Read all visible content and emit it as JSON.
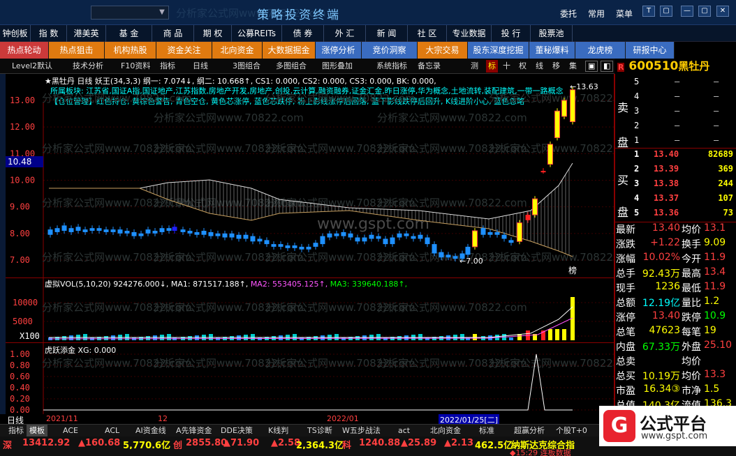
{
  "titlebar": {
    "app_title": "策略投资终端",
    "menu": [
      "委托",
      "常用",
      "菜单"
    ],
    "win_buttons": [
      "T",
      "▢",
      "—",
      "▢",
      "✕"
    ],
    "watermark_top": "分析家公式网www.70822.com"
  },
  "nav": [
    "钟创板",
    "指 数",
    "港美英",
    "基 金",
    "商 品",
    "期 权",
    "公募REITs",
    "债 券",
    "外 汇",
    "新 闻",
    "社 区",
    "专业数据",
    "投 行",
    "股票池"
  ],
  "subnav": [
    "热点轮动",
    "热点狙击",
    "机构热股",
    "资金关注",
    "北向资金",
    "大数据掘金",
    "涨停分析",
    "竞价洞察",
    "大宗交易",
    "股东深度挖掘",
    "董秘爆料",
    "龙虎榜",
    "研报中心"
  ],
  "toolbar": [
    "Level2默认",
    "技术分析",
    "F10资料",
    "指标",
    "日线",
    "3图组合",
    "多图组合",
    "图形叠加",
    "系统指标",
    "备忘录",
    "测",
    "标",
    "十",
    "权",
    "线",
    "移",
    "集"
  ],
  "stock": {
    "code": "600510",
    "name": "黑牡丹"
  },
  "indicator_line": "★黑牡丹 日线 妖王(34,3,3) 纲一: 7.074↓, 纲二: 10.668↑, CS1: 0.000, CS2: 0.000, CS3: 0.000, BK: 0.000,",
  "sector_line": "所属板块: 江苏省,国证A指,国证地产,江苏指数,房地产开发,房地产,创投,云计算,融资融券,证金汇金,昨日涨停,华为概念,土地流转,装配建筑,一带一路概念",
  "position_line": "【仓位管理】红色持仓, 黄棕色警告, 青色空仓, 黄色芯涨停, 蓝色芯跌停, 粉上影线涨停后回落, 蓝下影线跌停后回升, K线进阶小心, 蓝色忽略",
  "price_axis": [
    "13.00",
    "12.00",
    "11.00",
    "10.00",
    "9.00",
    "8.00",
    "7.00"
  ],
  "current_price_tag": "10.48",
  "high_marker": "13.63",
  "low_marker": "7.00",
  "bang_label": "榜",
  "vol_line": {
    "name": "虚拟VOL(5,10,20)",
    "v": "924276.000↓,",
    "ma1": "MA1: 871517.188↑,",
    "ma2": "MA2: 553405.125↑,",
    "ma3": "MA3: 339640.188↑,"
  },
  "vol_axis": [
    "10000",
    "5000",
    "X100"
  ],
  "sub_line": "虎跃添金 XG: 0.000",
  "sub_axis": [
    "1.00",
    "0.80",
    "0.60",
    "0.40",
    "0.20",
    "0.00"
  ],
  "date_axis": {
    "period": "日线",
    "d1": "2021/11",
    "d2": "12",
    "d3": "2022/01",
    "highlight": "2022/01/25[二]"
  },
  "bottom_tabs": [
    "指标",
    "模板",
    "ACE",
    "ACL",
    "AI资金线",
    "A先锋资金",
    "DDE决策",
    "K线判",
    "TS诊断",
    "W五步战法",
    "act",
    "北向资金",
    "标准",
    "超赢分析",
    "个股T+0"
  ],
  "index_bar": [
    {
      "t": "深",
      "c": "#ff4040"
    },
    {
      "t": "13412.92",
      "c": "#ff4040"
    },
    {
      "t": "▲160.68",
      "c": "#ff4040"
    },
    {
      "t": "5,770.6亿",
      "c": "#ffff00"
    },
    {
      "t": "创",
      "c": "#ff4040"
    },
    {
      "t": "2855.80",
      "c": "#ff4040"
    },
    {
      "t": "▲71.90",
      "c": "#ff4040"
    },
    {
      "t": "▲2.58",
      "c": "#ff4040"
    },
    {
      "t": "2,364.3亿",
      "c": "#ffff00"
    },
    {
      "t": "科",
      "c": "#ff4040"
    },
    {
      "t": "1240.88",
      "c": "#ff4040"
    },
    {
      "t": "▲25.89",
      "c": "#ff4040"
    },
    {
      "t": "▲2.13",
      "c": "#ff4040"
    },
    {
      "t": "462.5亿",
      "c": "#ffff00"
    },
    {
      "t": "纳斯达克综合指",
      "c": "#ffff00"
    }
  ],
  "ticker": "◆15:29 连板数据",
  "watermark": "分析家公式网www.70822.com",
  "gspt": "www.gspt.com",
  "orderbook": {
    "sell_label": [
      "卖",
      "盘"
    ],
    "buy_label": [
      "买",
      "盘"
    ],
    "sell": [
      {
        "n": "5",
        "p": "—",
        "v": "—"
      },
      {
        "n": "4",
        "p": "—",
        "v": "—"
      },
      {
        "n": "3",
        "p": "—",
        "v": "—"
      },
      {
        "n": "2",
        "p": "—",
        "v": "—"
      },
      {
        "n": "1",
        "p": "—",
        "v": "—"
      }
    ],
    "buy": [
      {
        "n": "1",
        "p": "13.40",
        "v": "82689"
      },
      {
        "n": "2",
        "p": "13.39",
        "v": "369"
      },
      {
        "n": "3",
        "p": "13.38",
        "v": "244"
      },
      {
        "n": "4",
        "p": "13.37",
        "v": "107"
      },
      {
        "n": "5",
        "p": "13.36",
        "v": "73"
      }
    ]
  },
  "stats": [
    {
      "l": "最新",
      "v": "13.40",
      "c": "#ff4040",
      "l2": "均价",
      "v2": "13.1",
      "c2": "#ff4040"
    },
    {
      "l": "涨跌",
      "v": "+1.22",
      "c": "#ff4040",
      "l2": "换手",
      "v2": "9.09",
      "c2": "#ffff00"
    },
    {
      "l": "涨幅",
      "v": "10.02%",
      "c": "#ff4040",
      "l2": "今开",
      "v2": "11.9",
      "c2": "#ff4040"
    },
    {
      "l": "总手",
      "v": "92.43万",
      "c": "#ffff00",
      "l2": "最高",
      "v2": "13.4",
      "c2": "#ff4040"
    },
    {
      "l": "现手",
      "v": "1236",
      "c": "#ffff00",
      "l2": "最低",
      "v2": "11.9",
      "c2": "#ff4040"
    },
    {
      "l": "总额",
      "v": "12.19亿",
      "c": "#00ffff",
      "l2": "量比",
      "v2": "1.2",
      "c2": "#ffff00"
    },
    {
      "l": "涨停",
      "v": "13.40",
      "c": "#ff4040",
      "l2": "跌停",
      "v2": "10.9",
      "c2": "#00ff00"
    },
    {
      "l": "总笔",
      "v": "47623",
      "c": "#ffff00",
      "l2": "每笔",
      "v2": "19",
      "c2": "#ffff00"
    },
    {
      "l": "内盘",
      "v": "67.33万",
      "c": "#00ff00",
      "l2": "外盘",
      "v2": "25.10",
      "c2": "#ff4040"
    },
    {
      "l": "总卖",
      "v": "",
      "c": "#ffff00",
      "l2": "均价",
      "v2": "",
      "c2": "#ff4040"
    },
    {
      "l": "总买",
      "v": "10.19万",
      "c": "#ffff00",
      "l2": "均价",
      "v2": "13.3",
      "c2": "#ff4040"
    },
    {
      "l": "市盈",
      "v": "16.34③",
      "c": "#ffff00",
      "l2": "市净",
      "v2": "1.5",
      "c2": "#ffff00"
    },
    {
      "l": "总值",
      "v": "140.3亿",
      "c": "#ffff00",
      "l2": "流值",
      "v2": "136.3",
      "c2": "#ffff00"
    }
  ],
  "logo": {
    "title": "公式平台",
    "url": "www.gspt.com",
    "mark": "G"
  },
  "colors": {
    "up": "#ff4040",
    "down": "#1e90ff",
    "limit": "#ffff00",
    "grid": "#8a0000"
  }
}
